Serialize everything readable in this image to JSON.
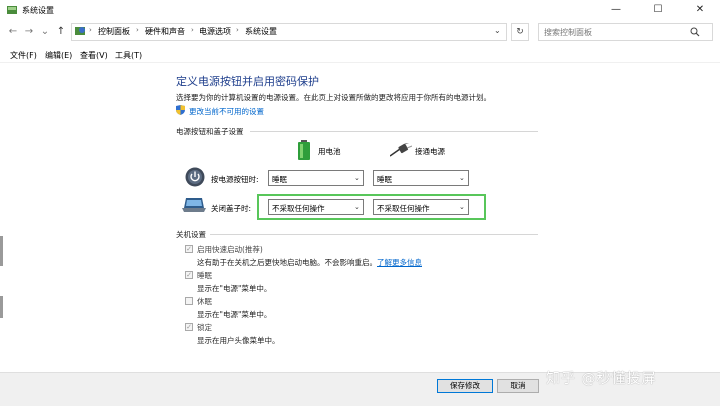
{
  "window": {
    "title": "系统设置",
    "minimize": "—",
    "maximize": "☐",
    "close": "✕"
  },
  "nav": {
    "back": "←",
    "forward": "→",
    "recent": "⌄",
    "up": "↑",
    "breadcrumb": [
      "控制面板",
      "硬件和声音",
      "电源选项",
      "系统设置"
    ],
    "dropdown": "⌄",
    "refresh": "↻",
    "search_placeholder": "搜索控制面板"
  },
  "menu": [
    "文件(F)",
    "编辑(E)",
    "查看(V)",
    "工具(T)"
  ],
  "content": {
    "heading": "定义电源按钮并启用密码保护",
    "subtitle": "选择要为你的计算机设置的电源设置。在此页上对设置所做的更改将应用于你所有的电源计划。",
    "change_link": "更改当前不可用的设置",
    "power_section": "电源按钮和盖子设置",
    "col_battery": "用电池",
    "col_plugged": "接通电源",
    "power_button": {
      "label": "按电源按钮时:",
      "battery": "睡眠",
      "plugged": "睡眠"
    },
    "lid": {
      "label": "关闭盖子时:",
      "battery": "不采取任何操作",
      "plugged": "不采取任何操作"
    },
    "shutdown_section": "关机设置",
    "fast_startup": {
      "label": "启用快速启动(推荐)",
      "desc": "这有助于在关机之后更快地启动电脑。不会影响重启。",
      "link": "了解更多信息",
      "checked": true
    },
    "sleep": {
      "label": "睡眠",
      "desc": "显示在\"电源\"菜单中。",
      "checked": true
    },
    "hibernate": {
      "label": "休眠",
      "desc": "显示在\"电源\"菜单中。",
      "checked": false
    },
    "lock": {
      "label": "锁定",
      "desc": "显示在用户头像菜单中。",
      "checked": true
    }
  },
  "buttons": {
    "save": "保存修改",
    "cancel": "取消"
  },
  "watermark": "知乎 @秒懂投屏",
  "colors": {
    "heading": "#1e3e8c",
    "link": "#0066cc",
    "highlight": "#58c65a",
    "primary_border": "#0078d7"
  }
}
